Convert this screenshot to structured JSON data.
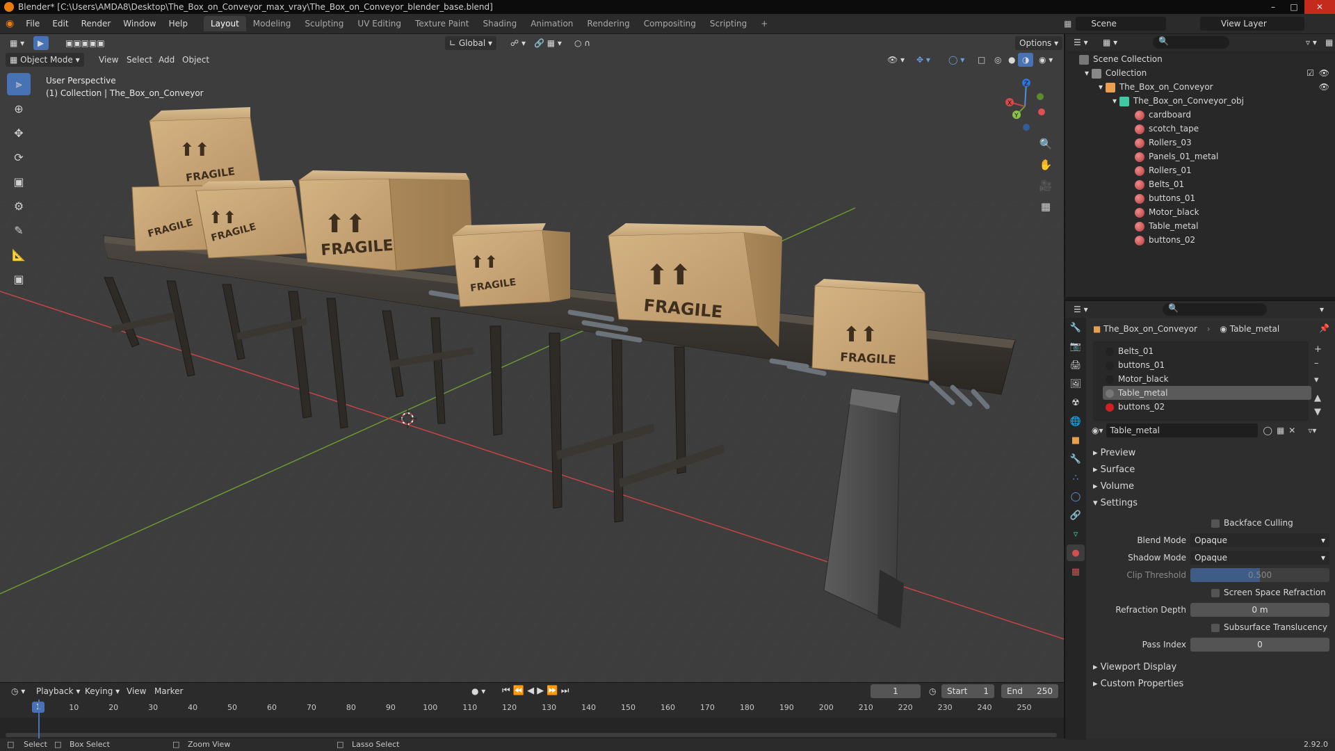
{
  "titlebar": {
    "title": "Blender* [C:\\Users\\AMDA8\\Desktop\\The_Box_on_Conveyor_max_vray\\The_Box_on_Conveyor_blender_base.blend]"
  },
  "menu": [
    "File",
    "Edit",
    "Render",
    "Window",
    "Help"
  ],
  "workspaces": [
    "Layout",
    "Modeling",
    "Sculpting",
    "UV Editing",
    "Texture Paint",
    "Shading",
    "Animation",
    "Rendering",
    "Compositing",
    "Scripting"
  ],
  "scene": {
    "label": "Scene",
    "view_layer": "View Layer"
  },
  "viewport_header": {
    "transform_orientation": "Global",
    "options": "Options",
    "mode": "Object Mode",
    "menus": [
      "View",
      "Select",
      "Add",
      "Object"
    ]
  },
  "viewport_info": {
    "line1": "User Perspective",
    "line2": "(1) Collection | The_Box_on_Conveyor"
  },
  "box_label": "FRAGILE",
  "outliner": {
    "root": "Scene Collection",
    "collection": "Collection",
    "object": "The_Box_on_Conveyor",
    "mesh": "The_Box_on_Conveyor_obj",
    "materials": [
      "cardboard",
      "scotch_tape",
      "Rollers_03",
      "Panels_01_metal",
      "Rollers_01",
      "Belts_01",
      "buttons_01",
      "Motor_black",
      "Table_metal",
      "buttons_02"
    ]
  },
  "properties": {
    "breadcrumb_object": "The_Box_on_Conveyor",
    "breadcrumb_material": "Table_metal",
    "slots": [
      "Belts_01",
      "buttons_01",
      "Motor_black",
      "Table_metal",
      "buttons_02"
    ],
    "active_material": "Table_metal",
    "sections": {
      "preview": "Preview",
      "surface": "Surface",
      "volume": "Volume",
      "settings": "Settings",
      "viewport_display": "Viewport Display",
      "custom_properties": "Custom Properties"
    },
    "settings": {
      "backface_culling": "Backface Culling",
      "blend_mode_label": "Blend Mode",
      "blend_mode": "Opaque",
      "shadow_mode_label": "Shadow Mode",
      "shadow_mode": "Opaque",
      "clip_threshold_label": "Clip Threshold",
      "clip_threshold": "0.500",
      "ssr": "Screen Space Refraction",
      "refraction_depth_label": "Refraction Depth",
      "refraction_depth": "0 m",
      "subsurface": "Subsurface Translucency",
      "pass_index_label": "Pass Index",
      "pass_index": "0"
    }
  },
  "timeline": {
    "menus": [
      "Playback",
      "Keying",
      "View",
      "Marker"
    ],
    "current_frame": "1",
    "start_label": "Start",
    "start": "1",
    "end_label": "End",
    "end": "250",
    "ticks": [
      "1",
      "10",
      "20",
      "30",
      "40",
      "50",
      "60",
      "70",
      "80",
      "90",
      "100",
      "110",
      "120",
      "130",
      "140",
      "150",
      "160",
      "170",
      "180",
      "190",
      "200",
      "210",
      "220",
      "230",
      "240",
      "250"
    ]
  },
  "statusbar": {
    "select": "Select",
    "box_select": "Box Select",
    "zoom_view": "Zoom View",
    "lasso_select": "Lasso Select",
    "version": "2.92.0"
  },
  "colors": {
    "accent": "#4772b3",
    "x_axis": "#c84444",
    "y_axis": "#6a9a32",
    "cardboard": "#c9a777",
    "metal": "#34302b"
  }
}
